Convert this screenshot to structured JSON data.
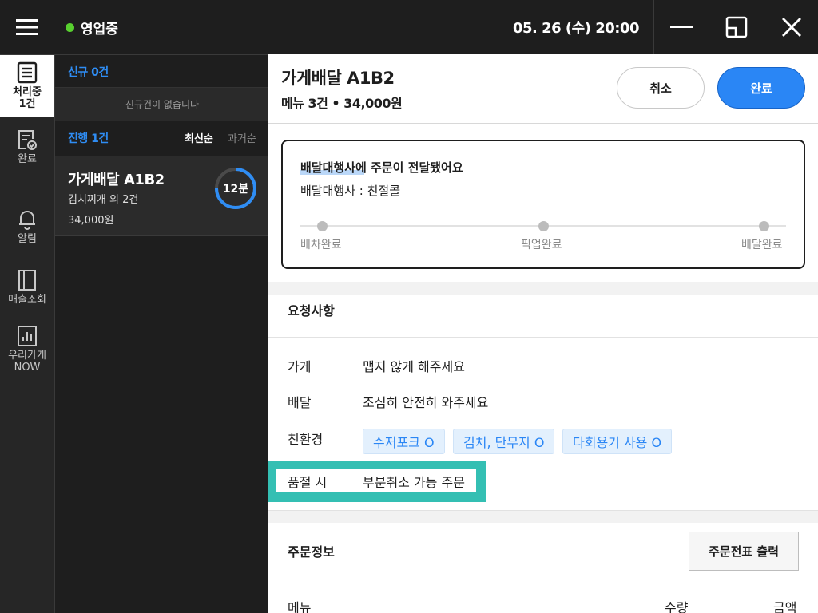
{
  "topbar": {
    "status": "영업중",
    "status_color": "#58d02f",
    "datetime": "05. 26 (수) 20:00",
    "icons": [
      "hamburger-icon",
      "minimize-icon",
      "restore-icon",
      "close-icon"
    ]
  },
  "nav": {
    "processing_label": "처리중",
    "processing_count": "1건",
    "done": "완료",
    "alerts": "알림",
    "sales": "매출조회",
    "store_now_1": "우리가게",
    "store_now_2": "NOW"
  },
  "list": {
    "new_header": "신규 0건",
    "new_empty": "신규건이 없습니다",
    "in_progress_header": "진행 1건",
    "sort_latest": "최신순",
    "sort_past": "과거순",
    "orders": [
      {
        "title": "가게배달 A1B2",
        "items": "김치찌개 외 2건",
        "price": "34,000원",
        "timer": "12분",
        "timer_progress": 0.75
      }
    ]
  },
  "detail": {
    "title": "가게배달 A1B2",
    "summary": "메뉴 3건 • 34,000원",
    "cancel_label": "취소",
    "done_label": "완료",
    "accent_color": "#2a86f5",
    "delivery": {
      "title": "배달대행사에 주문이 전달됐어요",
      "agency": "배달대행사 : 친절콜",
      "steps": [
        "배차완료",
        "픽업완료",
        "배달완료"
      ]
    },
    "requests": {
      "title": "요청사항",
      "store_label": "가게",
      "store_value": "맵지 않게 해주세요",
      "delivery_label": "배달",
      "delivery_value": "조심히 안전히 와주세요",
      "eco_label": "친환경",
      "eco_tags": [
        "수저포크 O",
        "김치, 단무지 O",
        "다회용기 사용 O"
      ],
      "soldout_label": "품절 시",
      "soldout_value": "부분취소 가능 주문",
      "highlight_color": "#34bfb3"
    },
    "order_info": {
      "title": "주문정보",
      "print_label": "주문전표 출력",
      "columns": [
        "메뉴",
        "수량",
        "금액"
      ]
    }
  }
}
